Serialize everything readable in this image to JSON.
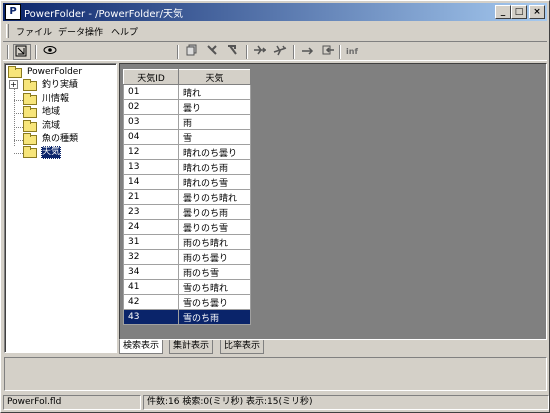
{
  "window": {
    "title": "PowerFolder - /PowerFolder/天気",
    "app_icon_letter": "P",
    "minimize": "_",
    "maximize": "□",
    "close": "×"
  },
  "menu": [
    "ファイル",
    "データ操作",
    "ヘルプ"
  ],
  "toolbar_icons": [
    "export-icon",
    "view-icon",
    "copy-icon",
    "cut-icon",
    "sort-icon",
    "plane-icon",
    "plane-alt-icon",
    "forward-icon",
    "back-icon",
    "info-icon"
  ],
  "toolbar": {
    "info_label": "inf"
  },
  "tree": {
    "root": "PowerFolder",
    "items": [
      "釣り実績",
      "川情報",
      "地域",
      "流域",
      "魚の種類",
      "天気"
    ],
    "selected": "天気",
    "expander": "+"
  },
  "grid": {
    "columns": [
      "天気ID",
      "天気"
    ],
    "rows": [
      [
        "01",
        "晴れ"
      ],
      [
        "02",
        "曇り"
      ],
      [
        "03",
        "雨"
      ],
      [
        "04",
        "雪"
      ],
      [
        "12",
        "晴れのち曇り"
      ],
      [
        "13",
        "晴れのち雨"
      ],
      [
        "14",
        "晴れのち雪"
      ],
      [
        "21",
        "曇りのち晴れ"
      ],
      [
        "23",
        "曇りのち雨"
      ],
      [
        "24",
        "曇りのち雪"
      ],
      [
        "31",
        "雨のち晴れ"
      ],
      [
        "32",
        "雨のち曇り"
      ],
      [
        "34",
        "雨のち雪"
      ],
      [
        "41",
        "雪のち晴れ"
      ],
      [
        "42",
        "雪のち曇り"
      ],
      [
        "43",
        "雪のち雨"
      ]
    ],
    "selected_index": 15
  },
  "tabs": [
    "検索表示",
    "集計表示",
    "比率表示"
  ],
  "active_tab": 0,
  "status": {
    "file": "PowerFol.fld",
    "stats": "件数:16  検索:0(ミリ秒)  表示:15(ミリ秒)"
  }
}
